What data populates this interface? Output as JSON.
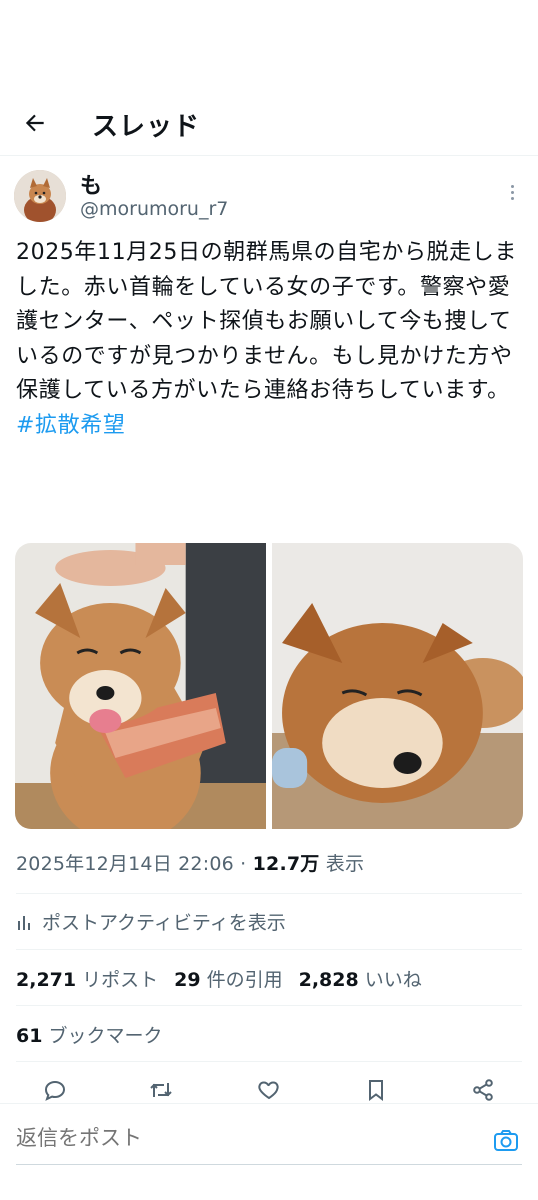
{
  "header": {
    "title": "スレッド",
    "back_icon": "arrow-left-icon"
  },
  "author": {
    "display_name": "も",
    "handle": "@morumoru_r7"
  },
  "post": {
    "text": "2025年11月25日の朝群馬県の自宅から脱走しました。赤い首輪をしている女の子です。警察や愛護センター、ペット探偵もお願いして今も捜しているのですが見つかりません。もし見かけた方や保護している方がいたら連絡お待ちしています。",
    "hashtag": "#拡散希望"
  },
  "meta": {
    "datetime": "2025年12月14日 22:06",
    "separator": " · ",
    "views": "12.7万",
    "views_label": " 表示"
  },
  "activity": {
    "label": "ポストアクティビティを表示"
  },
  "stats": {
    "reposts_count": "2,271",
    "reposts_label": "リポスト",
    "quotes_count": "29",
    "quotes_label": "件の引用",
    "likes_count": "2,828",
    "likes_label": "いいね"
  },
  "bookmarks": {
    "count": "61",
    "label": "ブックマーク"
  },
  "actions": [
    "reply-icon",
    "repost-icon",
    "like-icon",
    "bookmark-icon",
    "share-icon"
  ],
  "reply": {
    "placeholder": "返信をポスト"
  },
  "colors": {
    "accent": "#1d9bf0",
    "text": "#0f1419",
    "secondary": "#536471"
  }
}
